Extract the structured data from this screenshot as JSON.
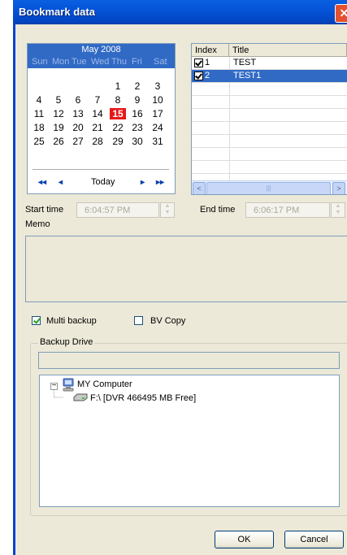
{
  "window": {
    "title": "Bookmark data",
    "close_glyph": "✕"
  },
  "calendar": {
    "month_label": "May 2008",
    "weekdays": [
      "Sun",
      "Mon",
      "Tue",
      "Wed",
      "Thu",
      "Fri",
      "Sat"
    ],
    "weeks": [
      [
        "",
        "",
        "",
        "",
        "1",
        "2",
        "3"
      ],
      [
        "4",
        "5",
        "6",
        "7",
        "8",
        "9",
        "10"
      ],
      [
        "11",
        "12",
        "13",
        "14",
        "15",
        "16",
        "17"
      ],
      [
        "18",
        "19",
        "20",
        "21",
        "22",
        "23",
        "24"
      ],
      [
        "25",
        "26",
        "27",
        "28",
        "29",
        "30",
        "31"
      ]
    ],
    "selected_day": "15",
    "nav_first": "◂◂",
    "nav_prev": "◂",
    "today_label": "Today",
    "nav_next": "▸",
    "nav_last": "▸▸"
  },
  "bookmark_list": {
    "columns": [
      "Index",
      "Title"
    ],
    "rows": [
      {
        "index": "1",
        "title": "TEST",
        "checked": true,
        "selected": false
      },
      {
        "index": "2",
        "title": "TEST1",
        "checked": true,
        "selected": true
      }
    ],
    "scroll_left": "<",
    "scroll_right": ">",
    "scroll_thumb": "|||"
  },
  "start_time": {
    "label": "Start time",
    "value": "6:04:57 PM"
  },
  "end_time": {
    "label": "End time",
    "value": "6:06:17 PM"
  },
  "memo": {
    "label": "Memo",
    "value": ""
  },
  "options": {
    "multi_backup": {
      "label": "Multi backup",
      "checked": true
    },
    "bv_copy": {
      "label": "BV Copy",
      "checked": false
    }
  },
  "backup_drive": {
    "group_label": "Backup Drive",
    "path_value": "",
    "tree": {
      "root_label": "MY Computer",
      "drive_label": "F:\\ [DVR 466495 MB Free]"
    }
  },
  "buttons": {
    "ok": "OK",
    "cancel": "Cancel"
  },
  "icons": {
    "computer": "computer-icon",
    "drive": "drive-icon"
  },
  "colors": {
    "title_bar": "#0454d8",
    "selection": "#316ac5",
    "today": "#e81818",
    "dialog_bg": "#ece9d8"
  }
}
